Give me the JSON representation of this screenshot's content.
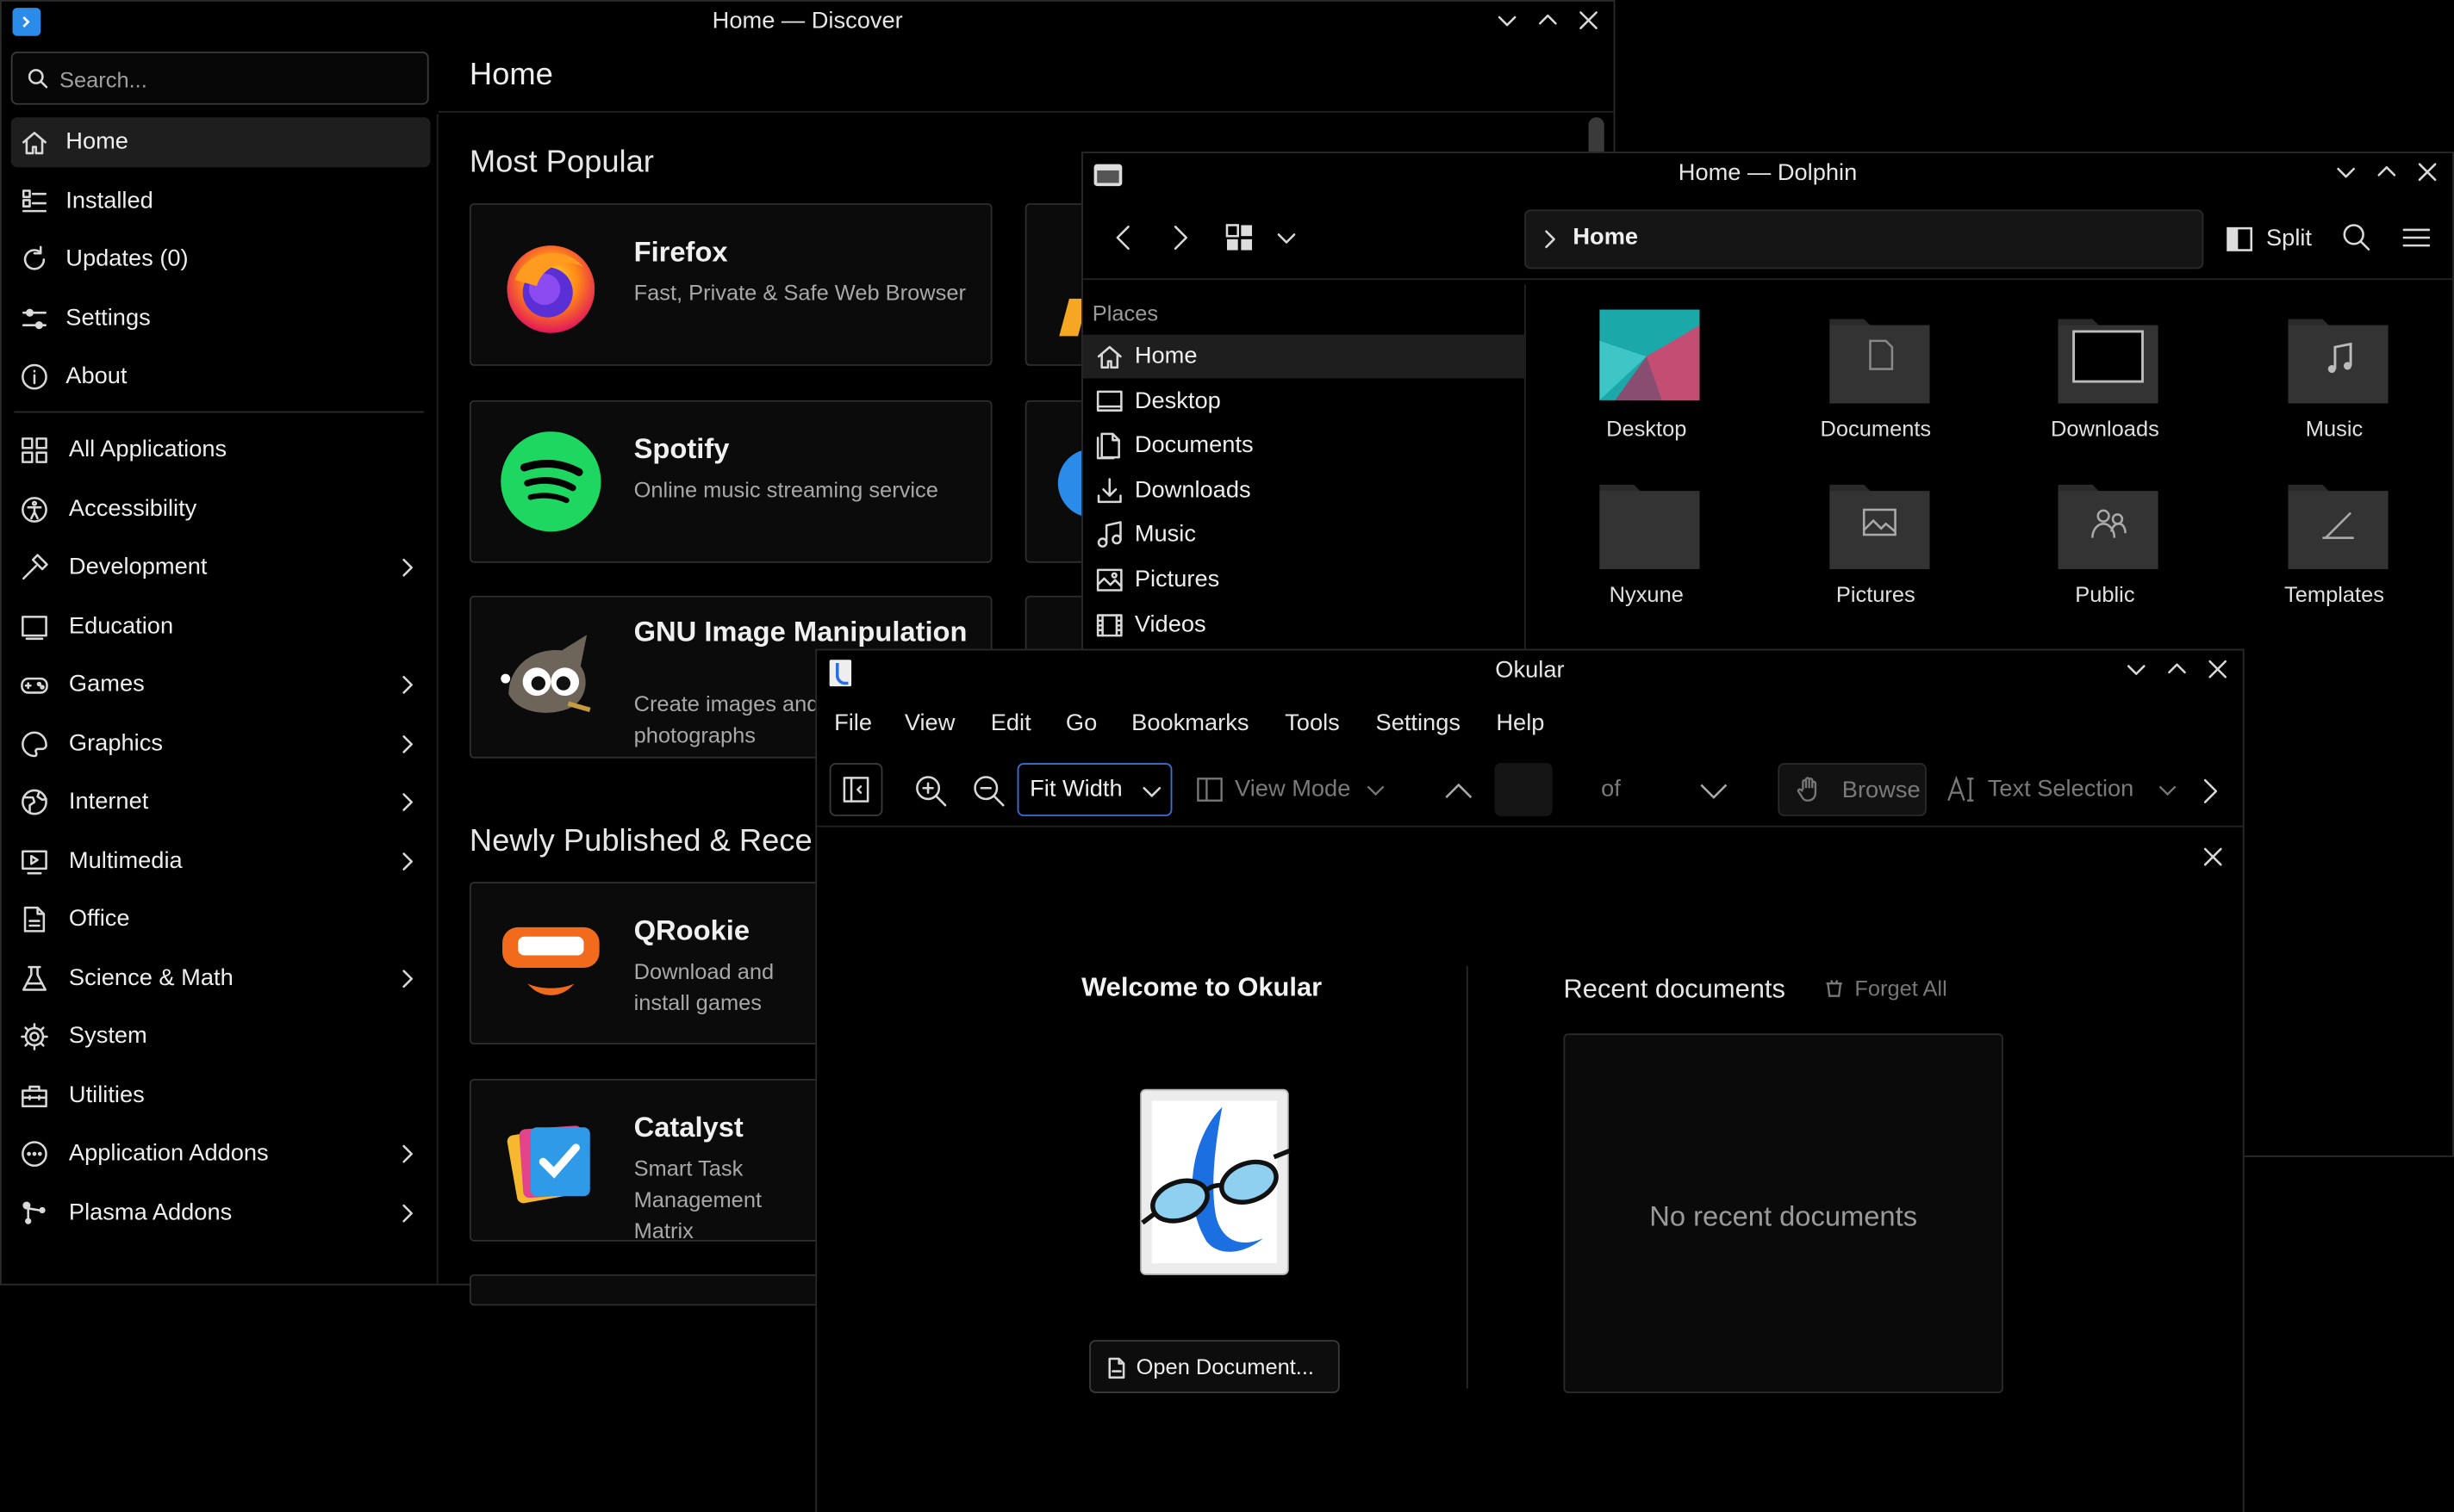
{
  "discover": {
    "title": "Home — Discover",
    "search_placeholder": "Search...",
    "page_title": "Home",
    "nav_top": [
      {
        "label": "Home",
        "icon": "home-icon"
      },
      {
        "label": "Installed",
        "icon": "installed-list-icon"
      },
      {
        "label": "Updates (0)",
        "icon": "updates-icon"
      },
      {
        "label": "Settings",
        "icon": "sliders-icon"
      },
      {
        "label": "About",
        "icon": "info-icon"
      }
    ],
    "nav_categories": [
      {
        "label": "All Applications",
        "icon": "grid-icon",
        "chevron": false
      },
      {
        "label": "Accessibility",
        "icon": "accessibility-icon",
        "chevron": false
      },
      {
        "label": "Development",
        "icon": "hammer-icon",
        "chevron": true
      },
      {
        "label": "Education",
        "icon": "education-icon",
        "chevron": false
      },
      {
        "label": "Games",
        "icon": "gamepad-icon",
        "chevron": true
      },
      {
        "label": "Graphics",
        "icon": "palette-icon",
        "chevron": true
      },
      {
        "label": "Internet",
        "icon": "globe-icon",
        "chevron": true
      },
      {
        "label": "Multimedia",
        "icon": "multimedia-icon",
        "chevron": true
      },
      {
        "label": "Office",
        "icon": "document-icon",
        "chevron": false
      },
      {
        "label": "Science & Math",
        "icon": "flask-icon",
        "chevron": true
      },
      {
        "label": "System",
        "icon": "gear-icon",
        "chevron": false
      },
      {
        "label": "Utilities",
        "icon": "toolbox-icon",
        "chevron": false
      },
      {
        "label": "Application Addons",
        "icon": "addons-icon",
        "chevron": true
      },
      {
        "label": "Plasma Addons",
        "icon": "plasma-icon",
        "chevron": true
      }
    ],
    "most_popular_title": "Most Popular",
    "newly_title": "Newly Published & Rece",
    "popular": [
      {
        "name": "Firefox",
        "desc": "Fast, Private & Safe Web Browser"
      },
      {
        "name": "Spotify",
        "desc": "Online music streaming service"
      },
      {
        "name": "GNU Image Manipulation",
        "desc": "Create images and edit photographs"
      }
    ],
    "newly": [
      {
        "name": "QRookie",
        "desc": "Download and install games"
      },
      {
        "name": "Catalyst",
        "desc": "Smart Task Management Matrix"
      }
    ]
  },
  "dolphin": {
    "title": "Home — Dolphin",
    "breadcrumb": "Home",
    "split_label": "Split",
    "places_header": "Places",
    "places": [
      {
        "label": "Home",
        "icon": "home-icon"
      },
      {
        "label": "Desktop",
        "icon": "desktop-icon"
      },
      {
        "label": "Documents",
        "icon": "documents-icon"
      },
      {
        "label": "Downloads",
        "icon": "download-icon"
      },
      {
        "label": "Music",
        "icon": "music-icon"
      },
      {
        "label": "Pictures",
        "icon": "pictures-icon"
      },
      {
        "label": "Videos",
        "icon": "videos-icon"
      }
    ],
    "folders": [
      {
        "label": "Desktop",
        "icon": "desktop-folder-icon"
      },
      {
        "label": "Documents",
        "icon": "documents-folder-icon"
      },
      {
        "label": "Downloads",
        "icon": "downloads-folder-icon"
      },
      {
        "label": "Music",
        "icon": "music-folder-icon"
      },
      {
        "label": "Nyxune",
        "icon": "folder-icon"
      },
      {
        "label": "Pictures",
        "icon": "pictures-folder-icon"
      },
      {
        "label": "Public",
        "icon": "public-folder-icon"
      },
      {
        "label": "Templates",
        "icon": "templates-folder-icon"
      }
    ]
  },
  "okular": {
    "title": "Okular",
    "menu": [
      "File",
      "View",
      "Edit",
      "Go",
      "Bookmarks",
      "Tools",
      "Settings",
      "Help"
    ],
    "zoom_value": "Fit Width",
    "view_mode_label": "View Mode",
    "page_of": "of",
    "browse_label": "Browse",
    "text_selection_label": "Text Selection",
    "welcome_title": "Welcome to Okular",
    "open_document_label": "Open Document...",
    "recent_title": "Recent documents",
    "forget_all_label": "Forget All",
    "no_recent": "No recent documents"
  },
  "colors": {
    "background": "#000000",
    "panel_active": "#1e1e1e",
    "accent_focus": "#3d6fd6",
    "spotify_green": "#1ed760",
    "qrookie_orange": "#f26b1d"
  }
}
